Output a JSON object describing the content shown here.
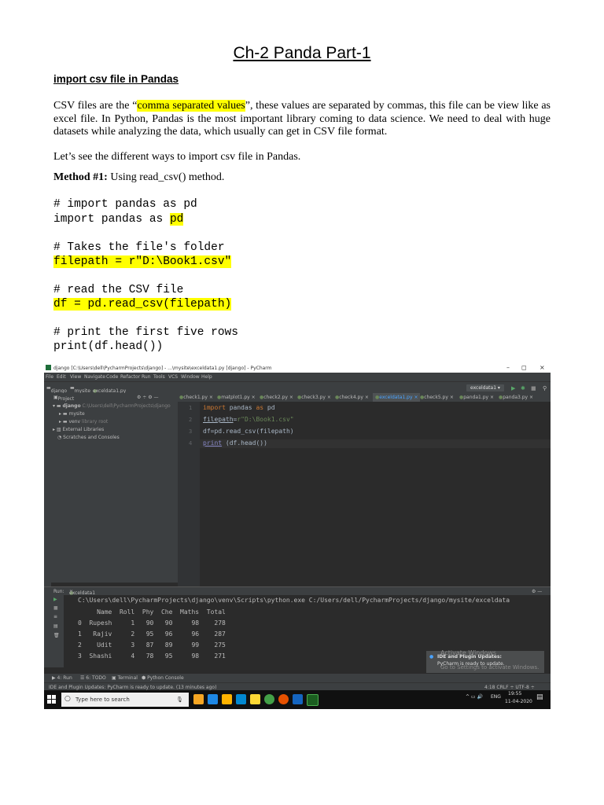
{
  "doc": {
    "title": "Ch-2 Panda Part-1",
    "heading": "import csv file in Pandas",
    "para1_a": "CSV files are the “",
    "para1_hl": "comma separated values",
    "para1_b": "”, these values are separated by commas, this file can be view like as excel file. In Python, Pandas is the most important library coming to data science. We need to deal with huge datasets while analyzing the data, which usually can get in CSV file format.",
    "para2": "Let’s see the different ways to import csv file in Pandas.",
    "method_bold": "Method #1:",
    "method_rest": " Using read_csv() method.",
    "code1_comment": "# import pandas as pd",
    "code1_line_pre": "import pandas as ",
    "code1_line_hl": "pd",
    "code2_comment": "# Takes the file's folder",
    "code2_line": "filepath = r\"D:\\Book1.csv\"",
    "code3_comment": "# read the CSV file",
    "code3_line": "df = pd.read_csv(filepath)",
    "code4_comment": "# print the first five rows",
    "code4_line": "print(df.head())"
  },
  "ide": {
    "window_title": "django [C:\\Users\\dell\\PycharmProjects\\django] - ...\\mysite\\exceldata1.py [django] - PyCharm",
    "window_controls": [
      "–",
      "◻",
      "×"
    ],
    "menu": [
      "File",
      "Edit",
      "View",
      "Navigate",
      "Code",
      "Refactor",
      "Run",
      "Tools",
      "VCS",
      "Window",
      "Help"
    ],
    "breadcrumb": [
      "django",
      "mysite",
      "exceldata1.py"
    ],
    "run_config": "exceldata1 ▾",
    "project_label": "Project ▾",
    "tree": {
      "root": "django",
      "root_path": "C:\\Users\\dell\\PycharmProjects\\django",
      "mysite": "mysite",
      "venv": "venv",
      "venv_note": "library root",
      "external": "External Libraries",
      "scratches": "Scratches and Consoles"
    },
    "tabs": [
      "check1.py",
      "matplot1.py",
      "check2.py",
      "check3.py",
      "check4.py",
      "exceldata1.py",
      "check5.py",
      "panda1.py",
      "panda3.py"
    ],
    "line_numbers": [
      "1",
      "2",
      "3",
      "4"
    ],
    "code": {
      "l1_kw": "import",
      "l1_mid": " pandas ",
      "l1_kw2": "as",
      "l1_end": " pd",
      "l2_var": "filepath",
      "l2_eq": "=",
      "l2_str": "r\"D:\\Book1.csv\"",
      "l3": "df=pd.read_csv(filepath)",
      "l4_fn": "print",
      "l4_rest": " (df.head())"
    },
    "run_tab_label": "Run:",
    "run_tab_name": "exceldata1",
    "console": {
      "command": "C:\\Users\\dell\\PycharmProjects\\django\\venv\\Scripts\\python.exe C:/Users/dell/PycharmProjects/django/mysite/exceldata",
      "header": "     Name  Roll  Phy  Che  Maths  Total",
      "rows": [
        "0  Rupesh     1   90   90     98    278",
        "1   Rajiv     2   95   96     96    287",
        "2    Udit     3   87   89     99    275",
        "3  Shashi     4   78   95     98    271"
      ]
    },
    "notification_title": "IDE and Plugin Updates:",
    "notification_body": "PyCharm is ready to update.",
    "watermark1": "Activate Windows",
    "watermark2": "Go to Settings to activate Windows.",
    "bottom_tools": [
      "▶ 4: Run",
      "☰ 6: TODO",
      "▣ Terminal",
      "⬢ Python Console"
    ],
    "status_text": "IDE and Plugin Updates: PyCharm is ready to update. (13 minutes ago)",
    "status_right": "4:18  CRLF ÷  UTF-8 ÷",
    "taskbar_search": "Type here to search",
    "tray_lang": "ENG",
    "tray_time": "19:55",
    "tray_date": "11-04-2020"
  },
  "colors": {
    "highlight": "#ffff00",
    "ide_bg": "#2b2b2b",
    "ide_panel": "#3c3f41"
  }
}
